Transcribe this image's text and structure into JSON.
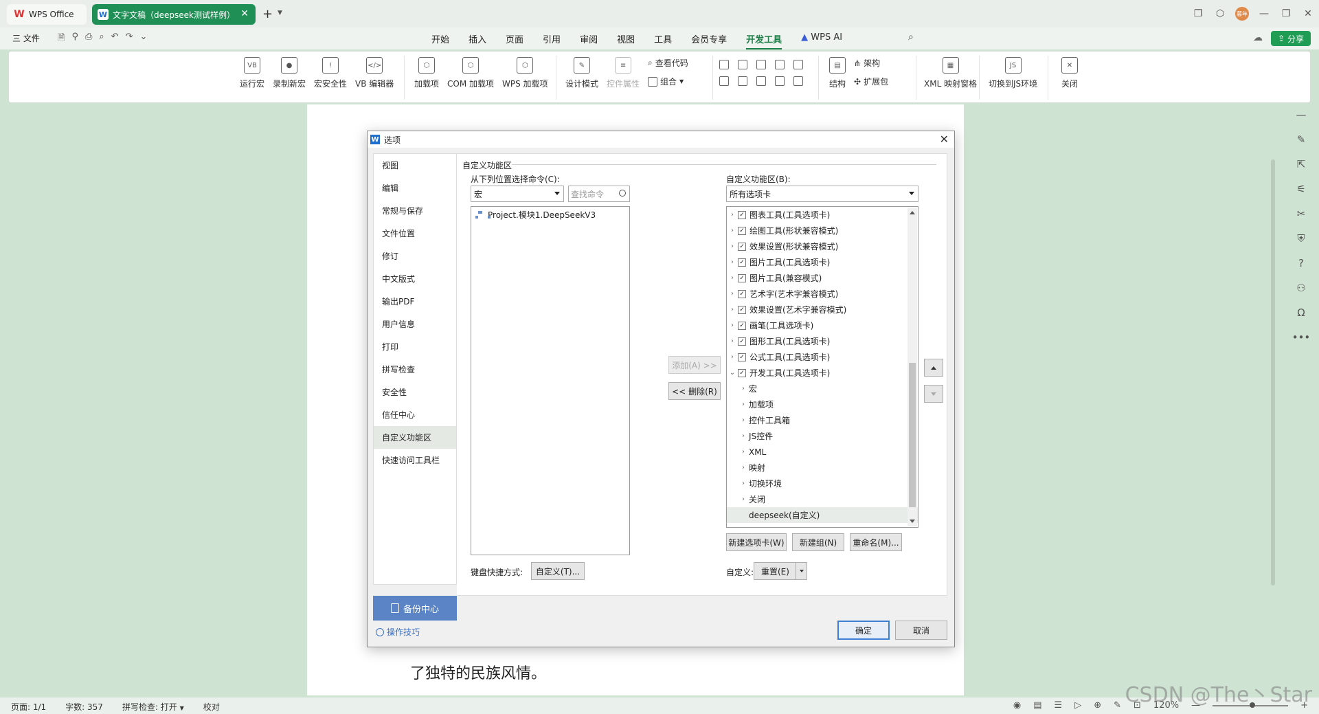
{
  "titlebar": {
    "tabs": [
      {
        "label": "WPS Office"
      },
      {
        "label": "文字文稿（deepseek测试样例）"
      }
    ],
    "avatar_text": "暮年"
  },
  "menubar": {
    "file": "三 文件",
    "items": [
      "开始",
      "插入",
      "页面",
      "引用",
      "审阅",
      "视图",
      "工具",
      "会员专享",
      "开发工具"
    ],
    "active_item": "开发工具",
    "ai": "WPS AI",
    "share": "分享"
  },
  "ribbon": {
    "macro_group": [
      "运行宏",
      "录制新宏",
      "宏安全性",
      "VB 编辑器"
    ],
    "addin_group": [
      "加载项",
      "COM 加载项",
      "WPS 加载项"
    ],
    "design_mode": "设计模式",
    "control_props": "控件属性",
    "view_code": "查看代码",
    "combine": "组合",
    "structure": "结构",
    "schema": "架构",
    "expansion": "扩展包",
    "xml_mapping": "XML 映射窗格",
    "switch_js": "切换到JS环境",
    "close": "关闭"
  },
  "document": {
    "visible_line": "了独特的民族风情。"
  },
  "statusbar": {
    "page": "页面: 1/1",
    "words": "字数: 357",
    "spell": "拼写检查: 打开",
    "proof": "校对",
    "zoom": "120%"
  },
  "watermark": "CSDN @The丶Star",
  "dialog": {
    "title": "选项",
    "nav": [
      "视图",
      "编辑",
      "常规与保存",
      "文件位置",
      "修订",
      "中文版式",
      "输出PDF",
      "用户信息",
      "打印",
      "拼写检查",
      "安全性",
      "信任中心",
      "自定义功能区",
      "快速访问工具栏"
    ],
    "active_nav": "自定义功能区",
    "backup": "备份中心",
    "tips": "操作技巧",
    "section_title": "自定义功能区",
    "choose_from_label": "从下列位置选择命令(C):",
    "choose_from_value": "宏",
    "search_placeholder": "查找命令",
    "commands": [
      "Project.模块1.DeepSeekV3"
    ],
    "customize_label": "自定义功能区(B):",
    "customize_value": "所有选项卡",
    "add_button": "添加(A) >>",
    "remove_button": "<< 删除(R)",
    "tabs_tree": [
      {
        "label": "图表工具(工具选项卡)",
        "checked": true,
        "expanded": false
      },
      {
        "label": "绘图工具(形状兼容模式)",
        "checked": true,
        "expanded": false
      },
      {
        "label": "效果设置(形状兼容模式)",
        "checked": true,
        "expanded": false
      },
      {
        "label": "图片工具(工具选项卡)",
        "checked": true,
        "expanded": false
      },
      {
        "label": "图片工具(兼容模式)",
        "checked": true,
        "expanded": false
      },
      {
        "label": "艺术字(艺术字兼容模式)",
        "checked": true,
        "expanded": false
      },
      {
        "label": "效果设置(艺术字兼容模式)",
        "checked": true,
        "expanded": false
      },
      {
        "label": "画笔(工具选项卡)",
        "checked": true,
        "expanded": false
      },
      {
        "label": "图形工具(工具选项卡)",
        "checked": true,
        "expanded": false
      },
      {
        "label": "公式工具(工具选项卡)",
        "checked": true,
        "expanded": false
      },
      {
        "label": "开发工具(工具选项卡)",
        "checked": true,
        "expanded": true
      }
    ],
    "dev_groups": [
      "宏",
      "加载项",
      "控件工具箱",
      "JS控件",
      "XML",
      "映射",
      "切换环境",
      "关闭"
    ],
    "custom_group": "deepseek(自定义)",
    "new_tab": "新建选项卡(W)",
    "new_group": "新建组(N)",
    "rename": "重命名(M)...",
    "shortcut_label": "键盘快捷方式:",
    "shortcut_button": "自定义(T)...",
    "customize_short": "自定义:",
    "reset": "重置(E)",
    "ok": "确定",
    "cancel": "取消"
  }
}
